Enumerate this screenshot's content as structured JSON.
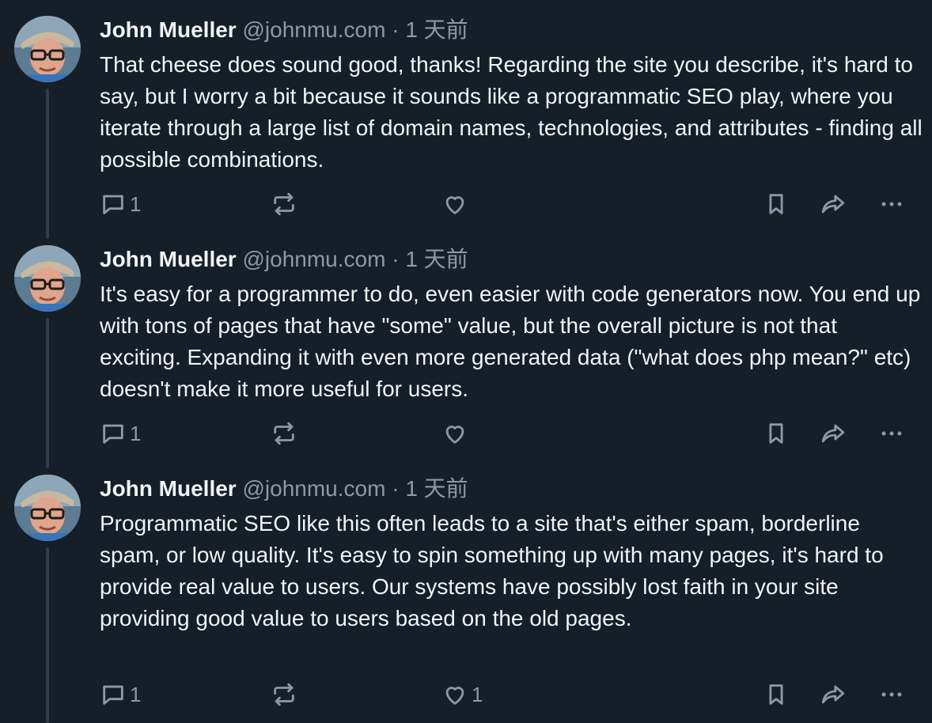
{
  "posts": [
    {
      "author": "John Mueller",
      "handle": "@johnmu.com",
      "separator": "·",
      "time": "1 天前",
      "text": "That cheese does sound good, thanks! Regarding the site you describe, it's hard to say, but I worry a bit because it sounds like a programmatic SEO play, where you iterate through a large list of domain names, technologies, and attributes - finding all possible combinations.",
      "reply_count": "1",
      "repost_count": "",
      "like_count": ""
    },
    {
      "author": "John Mueller",
      "handle": "@johnmu.com",
      "separator": "·",
      "time": "1 天前",
      "text": "It's easy for a programmer to do, even easier with code generators now. You end up with tons of pages that have \"some\" value, but the overall picture is not that exciting. Expanding it with even more generated data (\"what does php mean?\" etc) doesn't make it more useful for users.",
      "reply_count": "1",
      "repost_count": "",
      "like_count": ""
    },
    {
      "author": "John Mueller",
      "handle": "@johnmu.com",
      "separator": "·",
      "time": "1 天前",
      "text": "Programmatic SEO like this often leads to a site that's either spam, borderline spam, or low quality. It's easy to spin something up with many pages, it's hard to provide real value to users. Our systems have possibly lost faith in your site providing good value to users based on the old pages.",
      "reply_count": "1",
      "repost_count": "",
      "like_count": "1"
    }
  ],
  "icons": {
    "reply": "reply-icon",
    "repost": "repost-icon",
    "like": "heart-icon",
    "bookmark": "bookmark-icon",
    "share": "share-icon",
    "more": "more-icon"
  },
  "colors": {
    "background": "#161e27",
    "text": "#f1f3f5",
    "muted": "#8c99a9",
    "thread_line": "#323c48"
  }
}
